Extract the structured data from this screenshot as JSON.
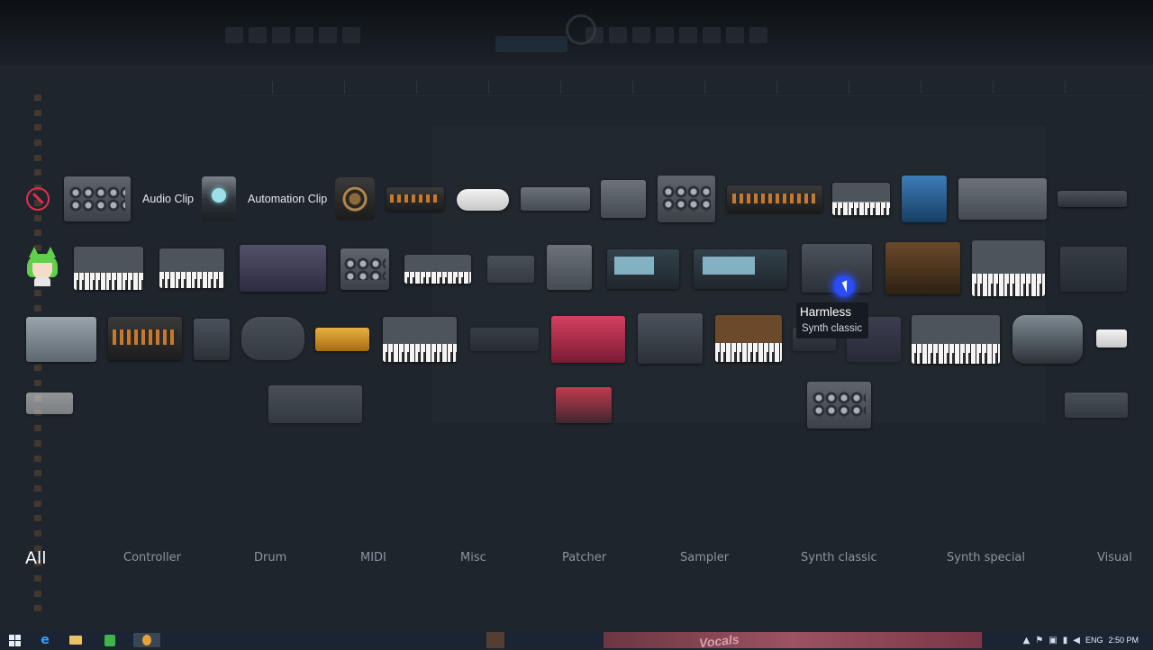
{
  "tooltip": {
    "title": "Harmless",
    "subtitle": "Synth classic"
  },
  "clips": {
    "audio": "Audio Clip",
    "automation": "Automation Clip"
  },
  "categories": [
    "All",
    "Controller",
    "Drum",
    "MIDI",
    "Misc",
    "Patcher",
    "Sampler",
    "Synth classic",
    "Synth special",
    "Visual"
  ],
  "active_category": "All",
  "icons": {
    "no_plugin": "no-plugin-icon",
    "automation": "automation-clip-icon",
    "mascot": "fl-mascot-icon",
    "start": "windows-start-icon",
    "browser": "internet-explorer-icon",
    "explorer": "file-explorer-icon"
  },
  "taskbar": {
    "language": "ENG",
    "time": "2:50 PM",
    "vocals_text": "Vocals"
  },
  "colors": {
    "accent": "#2a4cff",
    "no_plugin": "#e0304a",
    "active_category": "#ffffff",
    "inactive_category": "#8a96a2"
  }
}
